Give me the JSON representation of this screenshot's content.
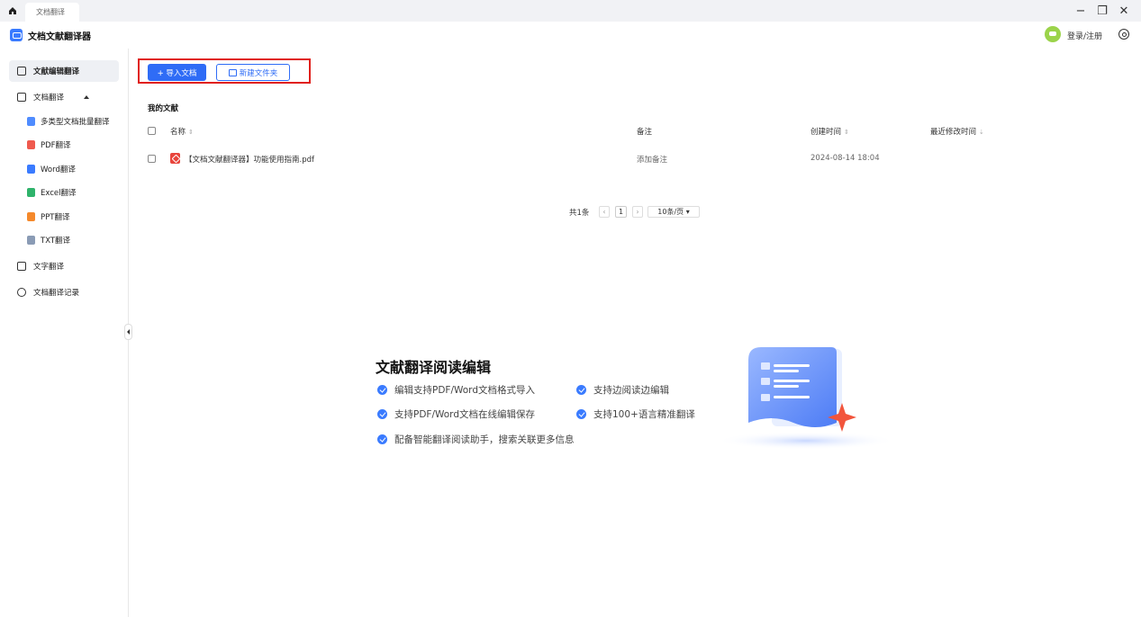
{
  "titlebar": {
    "tab_label": "文档翻译",
    "minimize": "−",
    "restore": "❐",
    "close": "✕"
  },
  "app": {
    "title": "文档文献翻译器",
    "login_label": "登录/注册"
  },
  "sidebar": {
    "items": [
      {
        "label": "文献编辑翻译",
        "icon": "document-edit-icon"
      },
      {
        "label": "文档翻译",
        "icon": "document-icon"
      },
      {
        "label": "文字翻译",
        "icon": "text-icon"
      },
      {
        "label": "文档翻译记录",
        "icon": "clock-icon"
      }
    ],
    "subitems": [
      {
        "label": "多类型文档批量翻译",
        "icon": "batch-icon",
        "color": "#4f8cff"
      },
      {
        "label": "PDF翻译",
        "icon": "pdf-icon",
        "color": "#ef5a4e"
      },
      {
        "label": "Word翻译",
        "icon": "word-icon",
        "color": "#3a7bff"
      },
      {
        "label": "Excel翻译",
        "icon": "excel-icon",
        "color": "#2fb36b"
      },
      {
        "label": "PPT翻译",
        "icon": "ppt-icon",
        "color": "#f5892b"
      },
      {
        "label": "TXT翻译",
        "icon": "txt-icon",
        "color": "#8a9bb5"
      }
    ]
  },
  "toolbar": {
    "import_label": "+ 导入文档",
    "new_folder_label": "新建文件夹"
  },
  "library": {
    "section_title": "我的文献",
    "columns": {
      "name": "名称",
      "note": "备注",
      "created": "创建时间",
      "modified": "最近修改时间"
    },
    "rows": [
      {
        "name": "【文档文献翻译器】功能使用指南.pdf",
        "note": "添加备注",
        "created": "2024-08-14 18:04",
        "modified": ""
      }
    ]
  },
  "pagination": {
    "total": "共1条",
    "prev": "‹",
    "page": "1",
    "next": "›",
    "page_size": "10条/页 ▾"
  },
  "promo": {
    "title": "文献翻译阅读编辑",
    "features": [
      "编辑支持PDF/Word文档格式导入",
      "支持边阅读边编辑",
      "支持PDF/Word文档在线编辑保存",
      "支持100+语言精准翻译",
      "配备智能翻译阅读助手，搜索关联更多信息"
    ]
  },
  "colors": {
    "primary": "#2f6cf6",
    "highlight": "#e0201b"
  }
}
